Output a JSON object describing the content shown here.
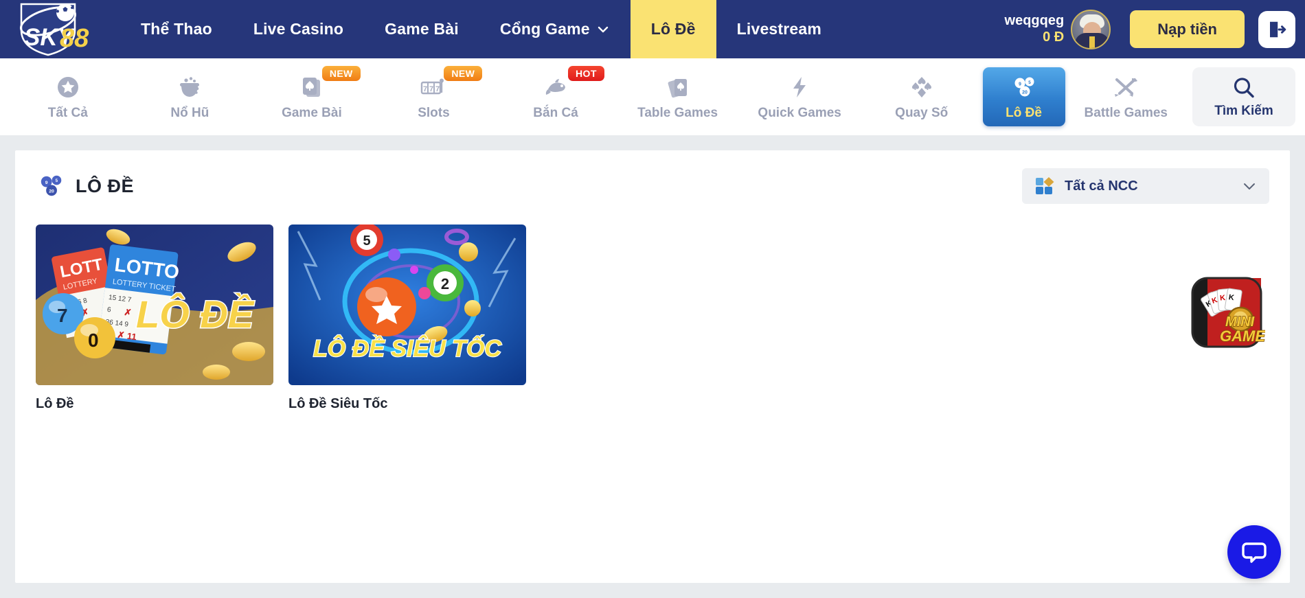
{
  "brand": {
    "name": "SKY88",
    "logo_text_primary": "SKY",
    "logo_text_accent": "88"
  },
  "header": {
    "nav": [
      {
        "label": "Thể Thao",
        "active": false,
        "caret": false
      },
      {
        "label": "Live Casino",
        "active": false,
        "caret": false
      },
      {
        "label": "Game Bài",
        "active": false,
        "caret": false
      },
      {
        "label": "Cổng Game",
        "active": false,
        "caret": true
      },
      {
        "label": "Lô Đề",
        "active": true,
        "caret": false
      },
      {
        "label": "Livestream",
        "active": false,
        "caret": false
      }
    ],
    "user": {
      "name": "weqgqeg",
      "balance": "0 Đ"
    },
    "deposit_label": "Nạp tiền",
    "logout_icon": "logout-icon",
    "avatar_icon": "avatar"
  },
  "categories": [
    {
      "label": "Tất Cả",
      "icon": "star-circle-icon",
      "badge": "",
      "active": false
    },
    {
      "label": "Nổ Hũ",
      "icon": "jackpot-pot-icon",
      "badge": "",
      "active": false
    },
    {
      "label": "Game Bài",
      "icon": "card-deck-icon",
      "badge": "NEW",
      "active": false
    },
    {
      "label": "Slots",
      "icon": "slot-machine-777-icon",
      "badge": "NEW",
      "active": false
    },
    {
      "label": "Bắn Cá",
      "icon": "fish-icon",
      "badge": "HOT",
      "active": false
    },
    {
      "label": "Table Games",
      "icon": "playing-cards-icon",
      "badge": "",
      "active": false
    },
    {
      "label": "Quick Games",
      "icon": "lightning-bolt-icon",
      "badge": "",
      "active": false
    },
    {
      "label": "Quay Số",
      "icon": "card-suits-icon",
      "badge": "",
      "active": false
    },
    {
      "label": "Lô Đề",
      "icon": "lottery-balls-icon",
      "badge": "",
      "active": true
    },
    {
      "label": "Battle Games",
      "icon": "crossed-swords-icon",
      "badge": "",
      "active": false
    }
  ],
  "search": {
    "label": "Tìm Kiếm",
    "icon": "search-icon"
  },
  "main": {
    "title": "LÔ ĐỀ",
    "title_icon": "lottery-balls-icon",
    "provider_filter": {
      "label": "Tất cả NCC",
      "icon": "grid-squares-icon",
      "chevron": "chevron-down-icon"
    },
    "games": [
      {
        "name": "Lô Đề",
        "thumb": "lo-de-lottery-tickets-art"
      },
      {
        "name": "Lô Đề Siêu Tốc",
        "thumb": "lo-de-sieu-toc-balls-art"
      }
    ]
  },
  "widgets": {
    "minigame": {
      "line1": "MINI",
      "line2": "GAME",
      "icon": "minigame-cards-icon"
    },
    "chat": {
      "icon": "chat-bubble-icon"
    }
  },
  "colors": {
    "header_navy": "#26367a",
    "accent_yellow": "#fae272",
    "active_blue": "#2f7fce",
    "page_bg": "#e8ebee",
    "muted_text": "#9aa0b5",
    "badge_new": "#f07c14",
    "badge_hot": "#e01b1b",
    "chat_blue": "#1a1ae6"
  }
}
